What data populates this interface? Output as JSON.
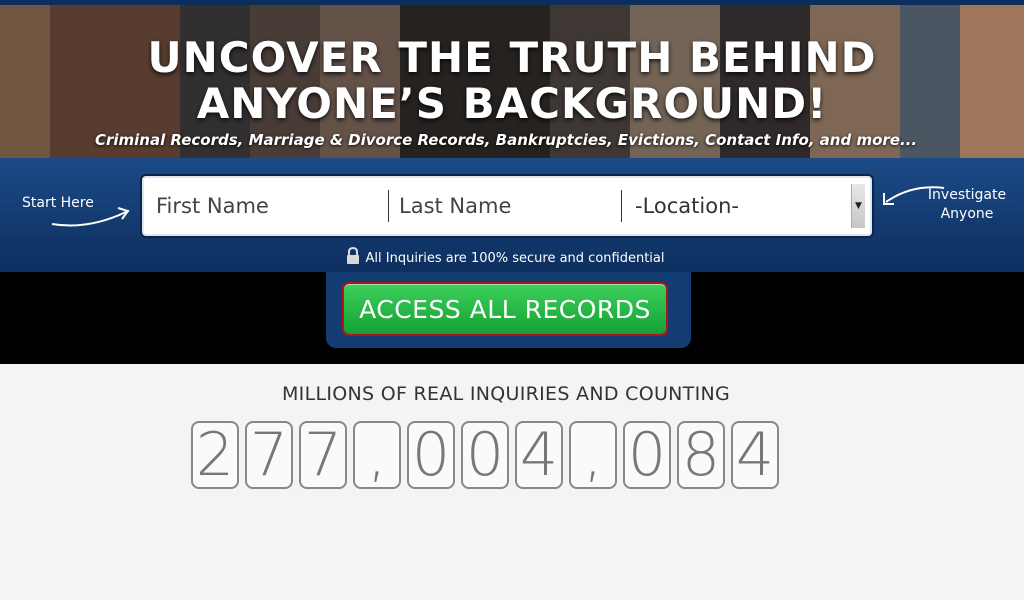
{
  "hero": {
    "headline_line1": "UNCOVER THE TRUTH BEHIND",
    "headline_line2": "ANYONE’S BACKGROUND!",
    "subline": "Criminal Records, Marriage & Divorce Records, Bankruptcies, Evictions, Contact Info, and more..."
  },
  "search": {
    "start_label": "Start Here",
    "first_name_placeholder": "First Name",
    "last_name_placeholder": "Last Name",
    "location_value": "-Location-",
    "investigate_line1": "Investigate",
    "investigate_line2": "Anyone",
    "secure_text": "All Inquiries are 100% secure and confidential"
  },
  "cta": {
    "button_label": "ACCESS ALL RECORDS"
  },
  "counter": {
    "title": "MILLIONS OF REAL INQUIRIES AND COUNTING",
    "digits": [
      "2",
      "7",
      "7",
      ",",
      "0",
      "0",
      "4",
      ",",
      "0",
      "8",
      "4"
    ]
  },
  "icons": {
    "lock": "lock-icon",
    "arrow_left": "curved-arrow-icon",
    "arrow_right": "curved-arrow-icon",
    "select_arrow": "dropdown-arrow-icon"
  },
  "colors": {
    "band_blue": "#123c72",
    "button_green": "#1fb343",
    "button_border": "#b3121b"
  }
}
